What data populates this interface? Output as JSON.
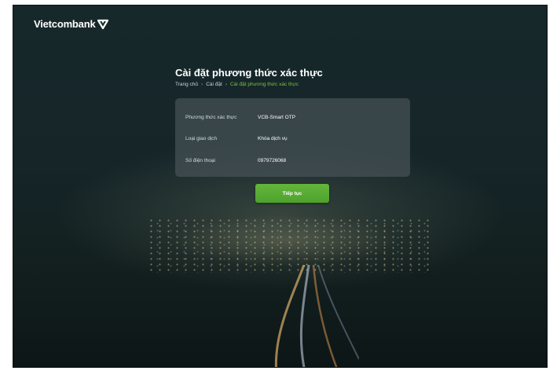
{
  "brand": {
    "name": "Vietcombank"
  },
  "page": {
    "title": "Cài đặt phương thức xác thực"
  },
  "breadcrumb": [
    "Trang chủ",
    "Cài đặt",
    "Cài đặt phương thức xác thực"
  ],
  "breadcrumb_sep": "›",
  "details": [
    {
      "label": "Phương thức xác thực",
      "value": "VCB-Smart OTP"
    },
    {
      "label": "Loại giao dịch",
      "value": "Khóa dịch vụ"
    },
    {
      "label": "Số điện thoại",
      "value": "0979726068"
    }
  ],
  "actions": {
    "continue_label": "Tiếp tục"
  },
  "colors": {
    "accent": "#5aad34",
    "breadcrumb_active": "#7bc043",
    "background": "#152528"
  }
}
